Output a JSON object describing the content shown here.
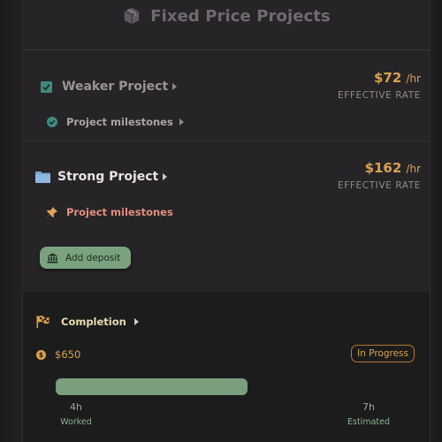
{
  "header": {
    "title": "Fixed Price Projects",
    "icon": "package-icon"
  },
  "projects": [
    {
      "name": "Weaker Project",
      "icon": "checkbox-icon",
      "rate_amount": "$72",
      "rate_unit": "/hr",
      "rate_label": "EFFECTIVE RATE",
      "milestones_label": "Project milestones",
      "milestones_icon": "check-circle-icon"
    },
    {
      "name": "Strong Project",
      "icon": "folder-icon",
      "rate_amount": "$162",
      "rate_unit": "/hr",
      "rate_label": "EFFECTIVE RATE",
      "milestones_label": "Project milestones",
      "milestones_icon": "pin-icon",
      "deposit_button": "Add deposit",
      "deposit_icon": "bank-icon"
    }
  ],
  "completion": {
    "title": "Completion",
    "icon": "checkered-flag-icon",
    "amount": "$650",
    "amount_icon": "coin-icon",
    "status": "In Progress",
    "progress_fraction": 0.57,
    "worked_value": "4h",
    "worked_label": "Worked",
    "estimated_value": "7h",
    "estimated_label": "Estimated"
  },
  "colors": {
    "accent_gold": "#d9a24e",
    "accent_green": "#7aa27f",
    "milestone_salmon": "#e08f7d",
    "teal": "#3e8a7f"
  }
}
